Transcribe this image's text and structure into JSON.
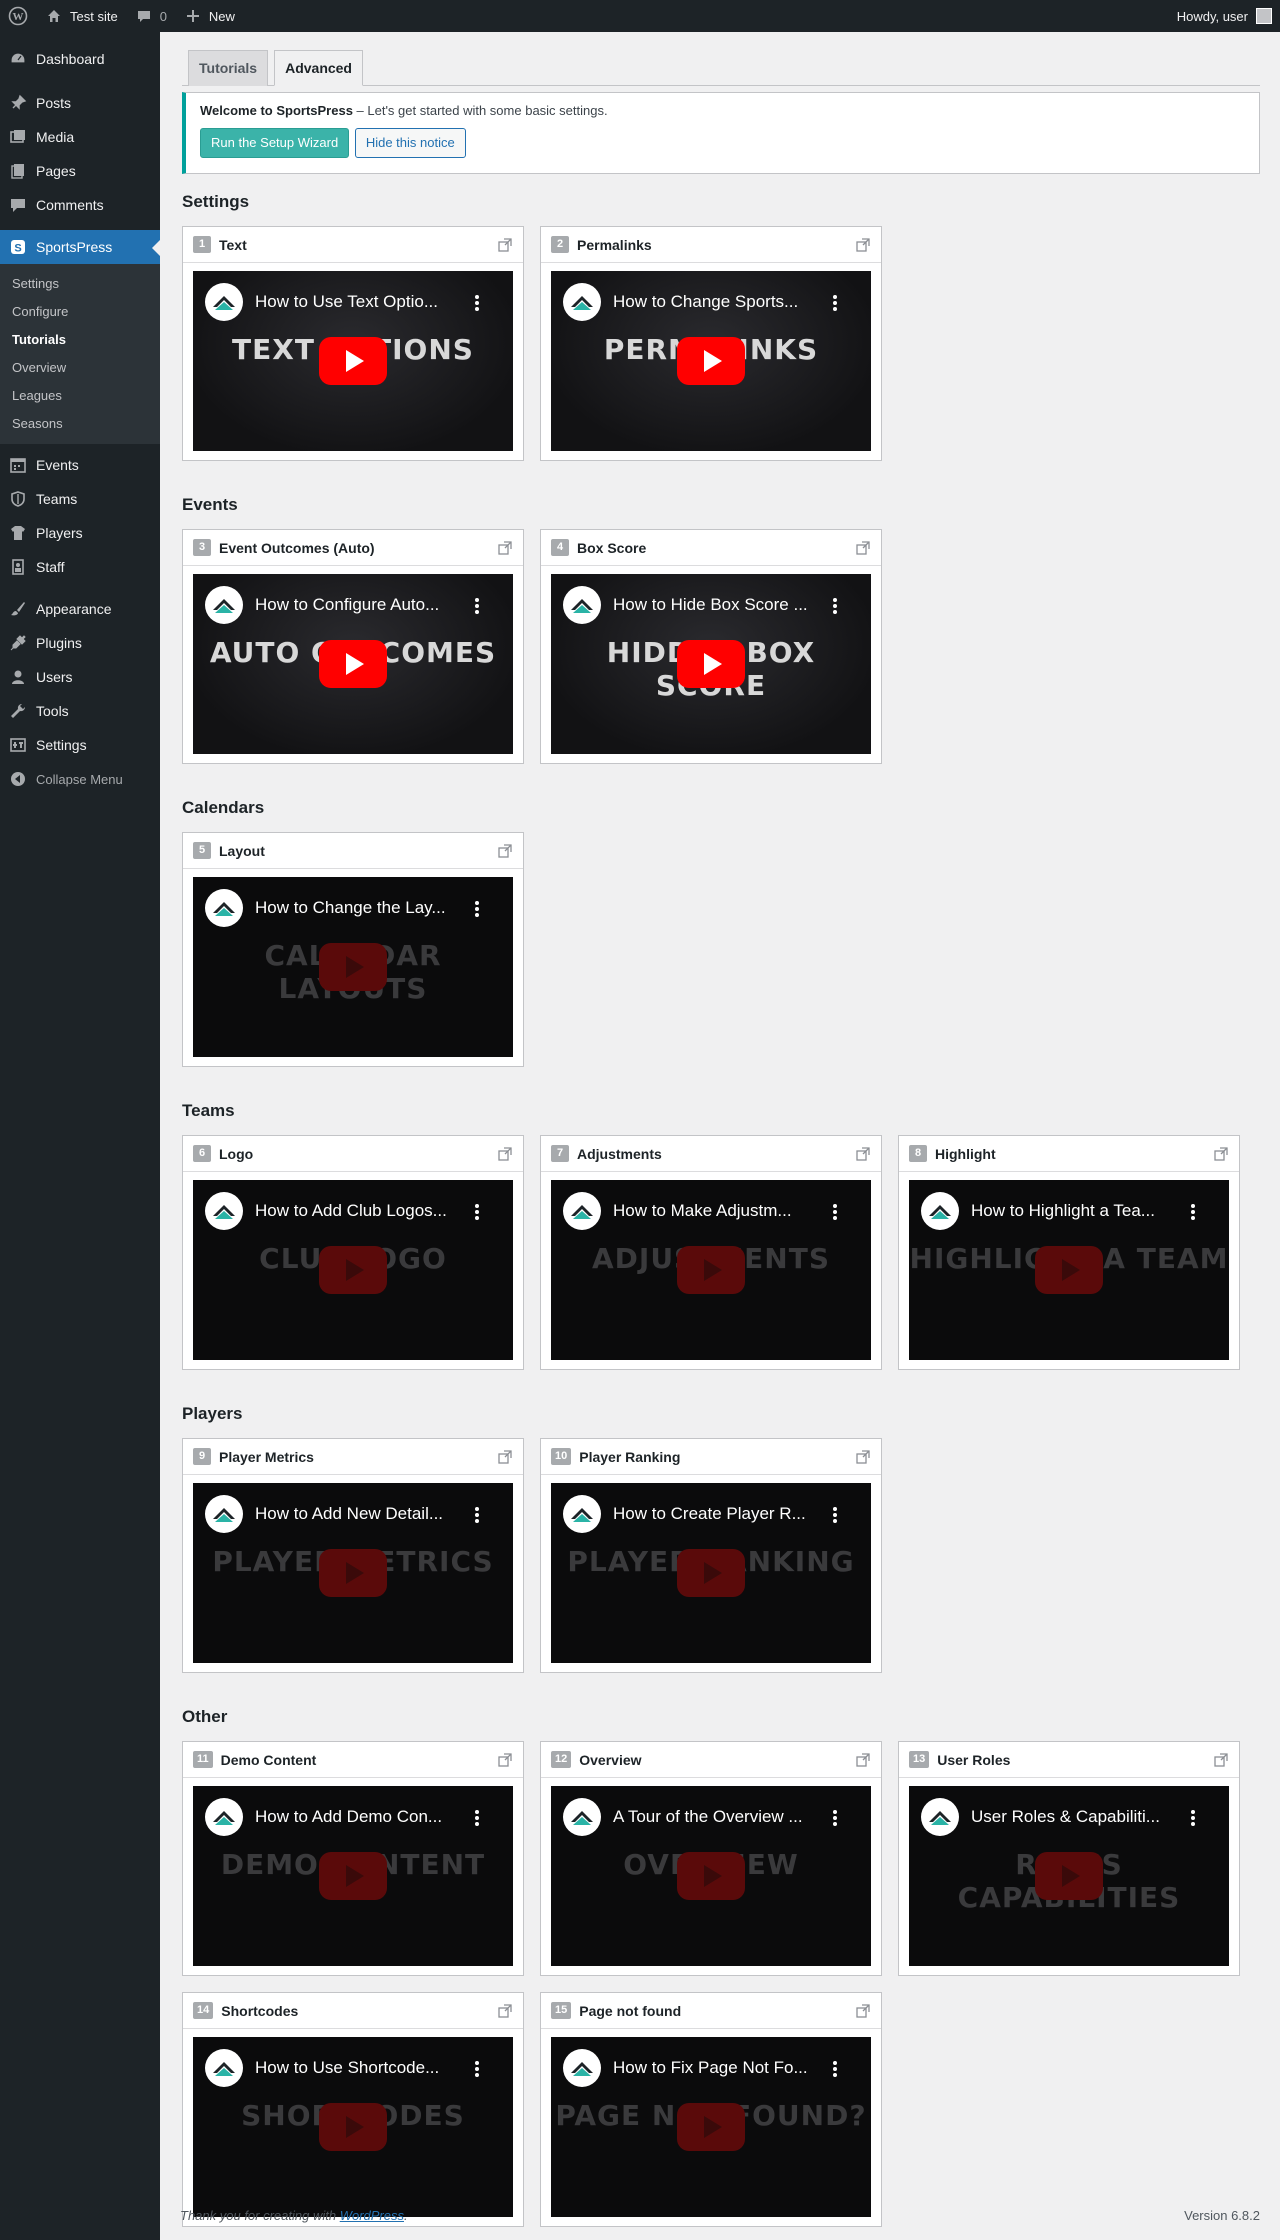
{
  "adminbar": {
    "site_name": "Test site",
    "comments_count": "0",
    "new_label": "New",
    "greeting": "Howdy, user"
  },
  "sidebar": {
    "items_top": [
      {
        "label": "Dashboard",
        "icon": "dashboard-icon"
      },
      {
        "label": "Posts",
        "icon": "pin-icon"
      },
      {
        "label": "Media",
        "icon": "media-icon"
      },
      {
        "label": "Pages",
        "icon": "pages-icon"
      },
      {
        "label": "Comments",
        "icon": "comments-icon"
      }
    ],
    "active": {
      "label": "SportsPress",
      "icon": "sportspress-icon"
    },
    "submenu": [
      "Settings",
      "Configure",
      "Tutorials",
      "Overview",
      "Leagues",
      "Seasons"
    ],
    "submenu_current": "Tutorials",
    "items_sports": [
      {
        "label": "Events",
        "icon": "calendar-icon"
      },
      {
        "label": "Teams",
        "icon": "shield-icon"
      },
      {
        "label": "Players",
        "icon": "shirt-icon"
      },
      {
        "label": "Staff",
        "icon": "id-badge-icon"
      }
    ],
    "items_bottom": [
      {
        "label": "Appearance",
        "icon": "brush-icon"
      },
      {
        "label": "Plugins",
        "icon": "plug-icon"
      },
      {
        "label": "Users",
        "icon": "users-icon"
      },
      {
        "label": "Tools",
        "icon": "wrench-icon"
      },
      {
        "label": "Settings",
        "icon": "sliders-icon"
      }
    ],
    "collapse_label": "Collapse Menu"
  },
  "tabs": [
    "Tutorials",
    "Advanced"
  ],
  "active_tab": "Advanced",
  "notice": {
    "title": "Welcome to SportsPress",
    "text": " – Let's get started with some basic settings.",
    "primary_button": "Run the Setup Wizard",
    "secondary_button": "Hide this notice"
  },
  "sections": [
    {
      "title": "Settings",
      "cards": [
        {
          "num": "1",
          "title": "Text",
          "video_title": "How to Use Text Optio...",
          "overlay": "TEXT OPTIONS",
          "dim": false
        },
        {
          "num": "2",
          "title": "Permalinks",
          "video_title": "How to Change Sports...",
          "overlay": "PERMALINKS",
          "dim": false
        }
      ]
    },
    {
      "title": "Events",
      "cards": [
        {
          "num": "3",
          "title": "Event Outcomes (Auto)",
          "video_title": "How to Configure Auto...",
          "overlay": "AUTO OUTCOMES",
          "dim": false
        },
        {
          "num": "4",
          "title": "Box Score",
          "video_title": "How to Hide Box Score ...",
          "overlay": "HIDDEN BOX SCORE",
          "dim": false
        }
      ]
    },
    {
      "title": "Calendars",
      "cards": [
        {
          "num": "5",
          "title": "Layout",
          "video_title": "How to Change the Lay...",
          "overlay": "CALENDAR LAYOUTS",
          "dim": true
        }
      ]
    },
    {
      "title": "Teams",
      "cards": [
        {
          "num": "6",
          "title": "Logo",
          "video_title": "How to Add Club Logos...",
          "overlay": "CLUB LOGO",
          "dim": true
        },
        {
          "num": "7",
          "title": "Adjustments",
          "video_title": "How to Make Adjustm...",
          "overlay": "ADJUSTMENTS",
          "dim": true
        },
        {
          "num": "8",
          "title": "Highlight",
          "video_title": "How to Highlight a Tea...",
          "overlay": "HIGHLIGHT A TEAM",
          "dim": true
        }
      ]
    },
    {
      "title": "Players",
      "cards": [
        {
          "num": "9",
          "title": "Player Metrics",
          "video_title": "How to Add New Detail...",
          "overlay": "PLAYER METRICS",
          "dim": true
        },
        {
          "num": "10",
          "title": "Player Ranking",
          "video_title": "How to Create Player R...",
          "overlay": "PLAYER RANKING",
          "dim": true
        }
      ]
    },
    {
      "title": "Other",
      "cards": [
        {
          "num": "11",
          "title": "Demo Content",
          "video_title": "How to Add Demo Con...",
          "overlay": "DEMO CONTENT",
          "dim": true
        },
        {
          "num": "12",
          "title": "Overview",
          "video_title": "A Tour of the Overview ...",
          "overlay": "OVERVIEW",
          "dim": true
        },
        {
          "num": "13",
          "title": "User Roles",
          "video_title": "User Roles & Capabiliti...",
          "overlay": "ROLES CAPABILITIES",
          "dim": true
        },
        {
          "num": "14",
          "title": "Shortcodes",
          "video_title": "How to Use Shortcode...",
          "overlay": "SHORTCODES",
          "dim": true
        },
        {
          "num": "15",
          "title": "Page not found",
          "video_title": "How to Fix Page Not Fo...",
          "overlay": "PAGE NOT FOUND?",
          "dim": true
        }
      ]
    }
  ],
  "footer": {
    "thanks_prefix": "Thank you for creating with ",
    "link": "WordPress",
    "thanks_suffix": ".",
    "version": "Version 6.8.2"
  },
  "colors": {
    "accent": "#2271b1",
    "brand": "#3bb3a9",
    "adminbar": "#1d2327"
  }
}
